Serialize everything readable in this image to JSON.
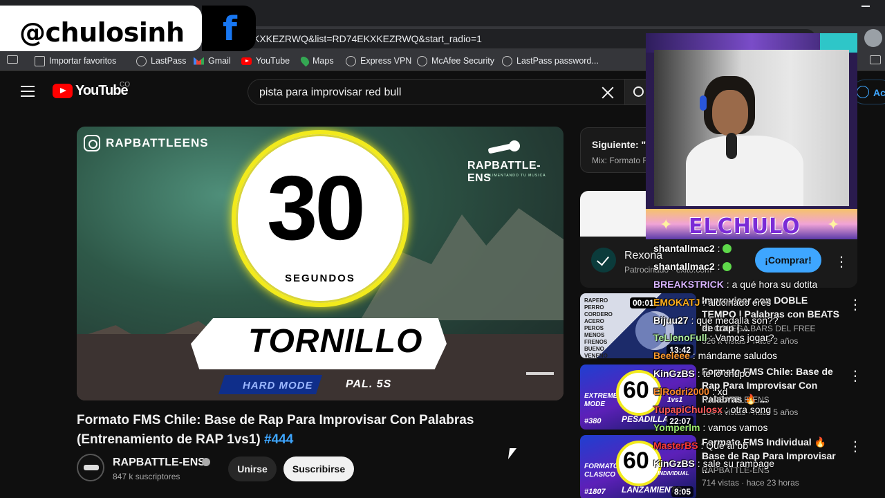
{
  "overlay": {
    "handle": "@chulosinh",
    "social_icon": "facebook-icon"
  },
  "browser": {
    "url": "KXKEZRWQ&list=RD74EKXKEZRWQ&start_radio=1",
    "bookmarks": [
      {
        "label": "Importar favoritos",
        "icon": "import-icon"
      },
      {
        "label": "LastPass",
        "icon": "globe-icon"
      },
      {
        "label": "Gmail",
        "icon": "gmail-icon"
      },
      {
        "label": "YouTube",
        "icon": "youtube-icon"
      },
      {
        "label": "Maps",
        "icon": "maps-icon"
      },
      {
        "label": "Express VPN",
        "icon": "globe-icon"
      },
      {
        "label": "McAfee Security",
        "icon": "globe-icon"
      },
      {
        "label": "LastPass password...",
        "icon": "globe-icon"
      }
    ]
  },
  "youtube": {
    "wordmark": "YouTube",
    "country": "CO",
    "search_query": "pista para improvisar red bull",
    "account_label": "Ac",
    "brand_color": "#ff0000",
    "accent_color": "#3ea6ff"
  },
  "thumbnail": {
    "ig_handle": "RAPBATTLEENS",
    "brand": "RAPBATTLE-ENS",
    "tagline": "ALIMENTANDO TU MUSICA",
    "number": "30",
    "unit": "SEGUNDOS",
    "word": "TORNILLO",
    "mode": "HARD MODE",
    "pal": "PAL. 5S"
  },
  "video": {
    "title": "Formato FMS Chile: Base de Rap Para Improvisar Con Palabras (Entrenamiento de RAP 1vs1)",
    "hashtag": "#444",
    "channel": "RAPBATTLE-ENS",
    "subscribers": "847 k suscriptores",
    "join_label": "Unirse",
    "subscribe_label": "Suscribirse"
  },
  "next": {
    "title": "Siguiente: \"C",
    "subtitle": "Mix: Formato F"
  },
  "ad": {
    "brand": "Rexona",
    "sponsor": "Patrocinado · exito.com",
    "cta": "¡Comprar!"
  },
  "recommendations": [
    {
      "title": "Improvisar con DOBLE TEMPO | Palabras con BEATS de trap | ...",
      "channel": "EL COLEGA BARS DEL FREE",
      "meta": "326 k vistas · hace 2 años",
      "duration": "13:42",
      "thumb_words": "RAPERO\nPERRO\nCORDERO\nACERO\nPEROS\nMENOS\nFRENOS\nBUENO\nVENENO",
      "thumb_badge": "00:01"
    },
    {
      "title": "Formato FMS Chile: Base de Rap Para Improvisar Con Palabras 🔥 ...",
      "channel": "RAPBATTLE-ENS",
      "meta": "134 k vistas · hace 5 años",
      "duration": "22:07",
      "thumb_number": "60",
      "thumb_label": "EXTREME\nMODE",
      "thumb_foot": "PESADILLA",
      "thumb_tag": "#380",
      "thumb_vs": "1vs1"
    },
    {
      "title": "Formato FMS Individual 🔥 Base de Rap Para Improvisar ...",
      "channel": "RAPBATTLE-ENS",
      "meta": "714 vistas · hace 23 horas",
      "duration": "8:05",
      "thumb_number": "60",
      "thumb_label": "FORMATO\nCLASICO",
      "thumb_foot": "LANZAMIENTO",
      "thumb_tag": "#1807",
      "thumb_vs": "INDIVIDUAL"
    }
  ],
  "webcam": {
    "title": "ELCHULO"
  },
  "chat": [
    {
      "user": "shantallmac2",
      "msg": "",
      "emoji": true,
      "color": "#ffffff"
    },
    {
      "user": "shantallmac2",
      "msg": "",
      "emoji": true,
      "color": "#ffffff"
    },
    {
      "user": "BREAKSTRICK",
      "msg": "a qué hora su dotita",
      "color": "#d8b4ff"
    },
    {
      "user": "EMOKATJ",
      "msg": "alucinado eres",
      "color": "#ffb020"
    },
    {
      "user": "Bijuu27",
      "msg": "qué medalla son??",
      "color": "#ffffff"
    },
    {
      "user": "TeLlenoFull",
      "msg": "Vamos jogar?",
      "color": "#b0f0a0"
    },
    {
      "user": "Beeleee",
      "msg": "mándame saludos",
      "color": "#ff9a2e"
    },
    {
      "user": "KinGzBS",
      "msg": "te lo chupo",
      "color": "#ffffff"
    },
    {
      "user": "ElRodri2000",
      "msg": "xd",
      "color": "#ff8a2e"
    },
    {
      "user": "TupapiChulosx",
      "msg": "otra song",
      "color": "#ff5a5a"
    },
    {
      "user": "Yomperlm",
      "msg": "vamos vamos",
      "color": "#9be870"
    },
    {
      "user": "MasterBS",
      "msg": "Que al bb",
      "color": "#ff3a3a"
    },
    {
      "user": "KinGzBS",
      "msg": "sale su rampage",
      "color": "#ffffff"
    }
  ]
}
